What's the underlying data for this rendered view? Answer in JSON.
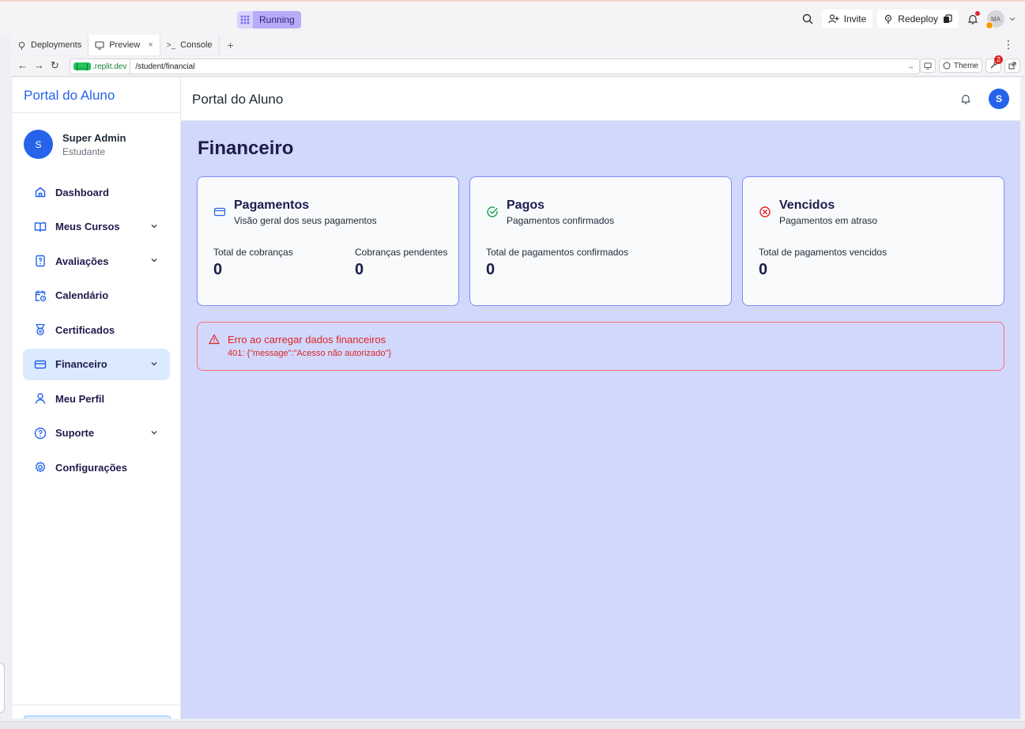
{
  "replit": {
    "status": "Running",
    "invite_label": "Invite",
    "redeploy_label": "Redeploy",
    "avatar_initials": "MA",
    "notification_count": "2",
    "tabs": [
      {
        "label": "Deployments"
      },
      {
        "label": "Preview"
      },
      {
        "label": "Console"
      }
    ],
    "url_host_badge": "{....}",
    "url_host": ".replit.dev",
    "url_path": "/student/financial",
    "theme_label": "Theme"
  },
  "sidebar": {
    "brand": "Portal do Aluno",
    "user": {
      "initial": "S",
      "name": "Super Admin",
      "role": "Estudante"
    },
    "items": [
      {
        "label": "Dashboard"
      },
      {
        "label": "Meus Cursos"
      },
      {
        "label": "Avaliações"
      },
      {
        "label": "Calendário"
      },
      {
        "label": "Certificados"
      },
      {
        "label": "Financeiro"
      },
      {
        "label": "Meu Perfil"
      },
      {
        "label": "Suporte"
      },
      {
        "label": "Configurações"
      }
    ],
    "active_item": "Financeiro"
  },
  "header": {
    "title": "Portal do Aluno",
    "avatar_initial": "S"
  },
  "page": {
    "title": "Financeiro",
    "cards": [
      {
        "title": "Pagamentos",
        "subtitle": "Visão geral dos seus pagamentos",
        "stats": [
          {
            "label": "Total de cobranças",
            "value": "0"
          },
          {
            "label": "Cobranças pendentes",
            "value": "0"
          }
        ]
      },
      {
        "title": "Pagos",
        "subtitle": "Pagamentos confirmados",
        "stats": [
          {
            "label": "Total de pagamentos confirmados",
            "value": "0"
          }
        ]
      },
      {
        "title": "Vencidos",
        "subtitle": "Pagamentos em atraso",
        "stats": [
          {
            "label": "Total de pagamentos vencidos",
            "value": "0"
          }
        ]
      }
    ],
    "error": {
      "title": "Erro ao carregar dados financeiros",
      "message": "401: {\"message\":\"Acesso não autorizado\"}"
    }
  },
  "colors": {
    "accent": "#2563eb",
    "main_background": "#d1d8fb",
    "card_border": "#818cf8",
    "error": "#dc2626",
    "success": "#16a34a"
  },
  "icons": {
    "nav": [
      "home-icon",
      "book-open-icon",
      "help-file-icon",
      "calendar-clock-icon",
      "award-icon",
      "credit-card-icon",
      "user-icon",
      "help-circle-icon",
      "gear-icon"
    ],
    "cards": [
      "credit-card-icon",
      "check-circle-icon",
      "x-circle-icon"
    ],
    "error": "alert-triangle-icon"
  }
}
